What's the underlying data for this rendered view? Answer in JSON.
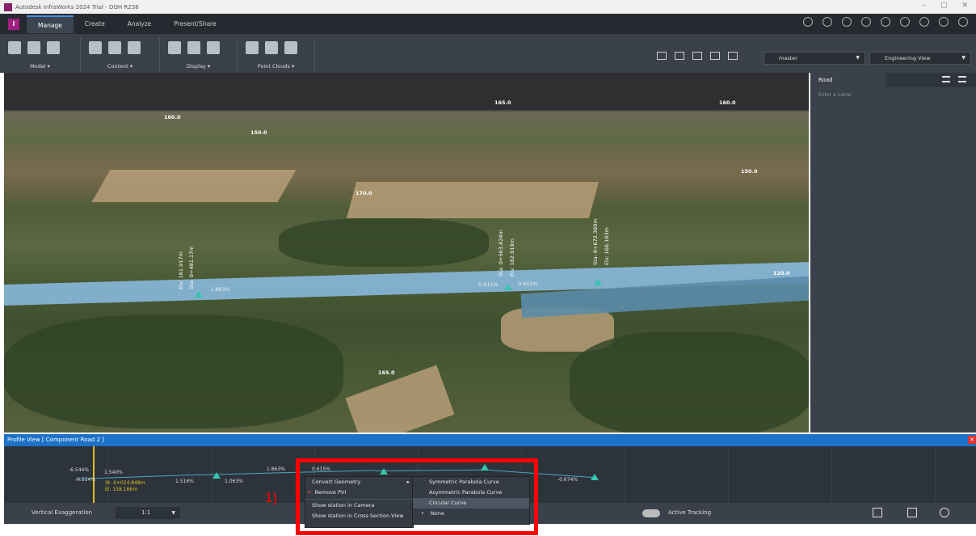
{
  "titlebar": {
    "title": "Autodesk InfraWorks 2024 Trial - DOH R238",
    "controls": [
      "–",
      "▢",
      "✕"
    ]
  },
  "tabs": [
    "Manage",
    "Create",
    "Analyze",
    "Present/Share"
  ],
  "ribbon": {
    "groups": [
      {
        "label": "Model ▾"
      },
      {
        "label": "Content ▾"
      },
      {
        "label": "Display ▾"
      },
      {
        "label": "Point Clouds ▾"
      }
    ],
    "proposal": "master",
    "view": "Engineering View"
  },
  "viewport": {
    "contours": [
      "165.0",
      "160.0",
      "160.0",
      "150.0",
      "150.0",
      "170.0",
      "120.0",
      "165.0"
    ],
    "stations": [
      {
        "sta": "Sta: 0+481.17m",
        "elv": "Elv: 161.917m"
      },
      {
        "sta": "Sta: 0+563.424m",
        "elv": "Elv: 162.919m"
      },
      {
        "sta": "Sta: 0+672.389m",
        "elv": "Elv: 166.183m"
      }
    ],
    "grades": [
      "1.863%",
      "0.615%",
      "0.615%"
    ]
  },
  "panel": {
    "title": "Road",
    "placeholder": "Enter a name"
  },
  "profile": {
    "title": "Profile View [ Component Road 2 ]",
    "labels": [
      "-6.544%",
      "-0.514%",
      "1.540%",
      "1.516%",
      "1.063%",
      "1.863%",
      "0.615%",
      "-0.674%"
    ],
    "station": "St: 0+024.848m",
    "elevation": "El: 158.166m"
  },
  "footer": {
    "vertical_label": "Vertical Exaggeration",
    "vertical_value": "1:1",
    "tracking_label": "Active Tracking"
  },
  "context_menu": {
    "items": [
      "Convert Geometry",
      "Remove PVI",
      "Show station in Camera",
      "Show station in Cross Section View"
    ],
    "submenu": [
      "Symmetric Parabola Curve",
      "Asymmetric Parabola Curve",
      "Circular Curve",
      "None"
    ]
  },
  "annotation": "1)"
}
